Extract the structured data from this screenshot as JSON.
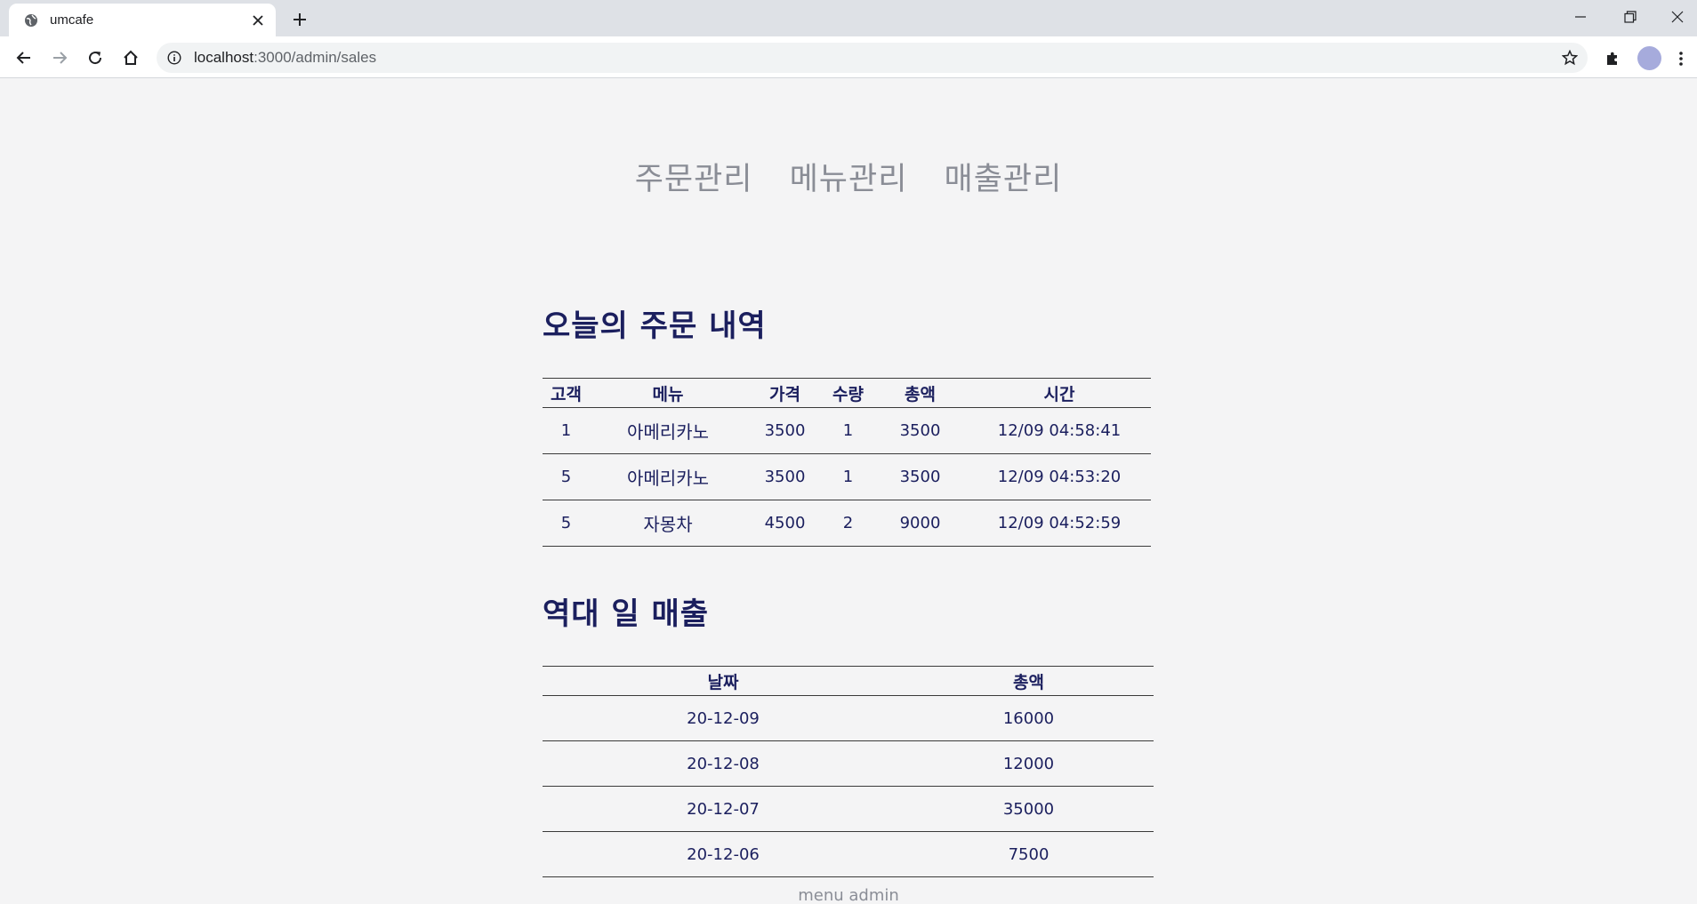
{
  "browser": {
    "tab_title": "umcafe",
    "url_host": "localhost",
    "url_path": ":3000/admin/sales"
  },
  "nav": {
    "items": [
      "주문관리",
      "메뉴관리",
      "매출관리"
    ]
  },
  "today_orders": {
    "heading": "오늘의 주문 내역",
    "columns": [
      "고객",
      "메뉴",
      "가격",
      "수량",
      "총액",
      "시간"
    ],
    "rows": [
      [
        "1",
        "아메리카노",
        "3500",
        "1",
        "3500",
        "12/09 04:58:41"
      ],
      [
        "5",
        "아메리카노",
        "3500",
        "1",
        "3500",
        "12/09 04:53:20"
      ],
      [
        "5",
        "자몽차",
        "4500",
        "2",
        "9000",
        "12/09 04:52:59"
      ]
    ]
  },
  "daily_sales": {
    "heading": "역대 일 매출",
    "columns": [
      "날짜",
      "총액"
    ],
    "rows": [
      [
        "20-12-09",
        "16000"
      ],
      [
        "20-12-08",
        "12000"
      ],
      [
        "20-12-07",
        "35000"
      ],
      [
        "20-12-06",
        "7500"
      ]
    ]
  },
  "footer": {
    "text": "menu admin"
  }
}
